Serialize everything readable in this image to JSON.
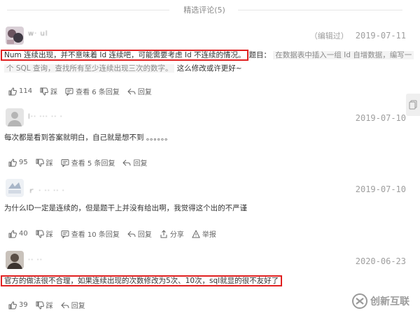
{
  "header": {
    "title": "精选评论(5)"
  },
  "comments": [
    {
      "nickname": "w· ul",
      "edited": "（编辑过）",
      "date": "2019-07-11",
      "line1_highlight": "Num 连续出现，并不意味着 Id 连续吧，可能需要考虑 Id 不连续的情况。",
      "line1_tail": "题目：",
      "line1_quote": "在数据表中插入一组 Id 自增数据，编写一",
      "line2_quote": "个 SQL 查询，查找所有至少连续出现三次的数字。",
      "line2_tail": " 这么修改或许更好~",
      "likes": "114",
      "dislike_label": "踩",
      "replies_label": "查看 6 条回复",
      "reply_label": "回复"
    },
    {
      "nickname": "l·· ··· ·· ·",
      "date": "2019-07-10",
      "text": "每次都是看到答案就明白，自己就是想不到 。。。。。。",
      "likes": "95",
      "dislike_label": "踩",
      "replies_label": "查看 5 条回复",
      "reply_label": "回复"
    },
    {
      "nickname": "ｒ ·  ·· ·· ·",
      "date": "2019-07-10",
      "text": "为什么ID一定是连续的，但是题干上并没有给出啊，我觉得这个出的不严谨",
      "likes": "40",
      "dislike_label": "踩",
      "replies_label": "查看 10 条回复",
      "reply_label": "回复",
      "share_label": "分享",
      "report_label": "举报"
    },
    {
      "nickname": "·· ··",
      "date": "2020-06-23",
      "text": "官方的做法很不合理，如果连续出现的次数修改为5次、10次，sql就显的很不友好了",
      "likes": "39",
      "dislike_label": "踩",
      "reply_label": "回复"
    }
  ],
  "watermark": {
    "text": "创新互联"
  },
  "colors": {
    "highlight_border": "#e02020",
    "muted": "#9e9e9e"
  }
}
